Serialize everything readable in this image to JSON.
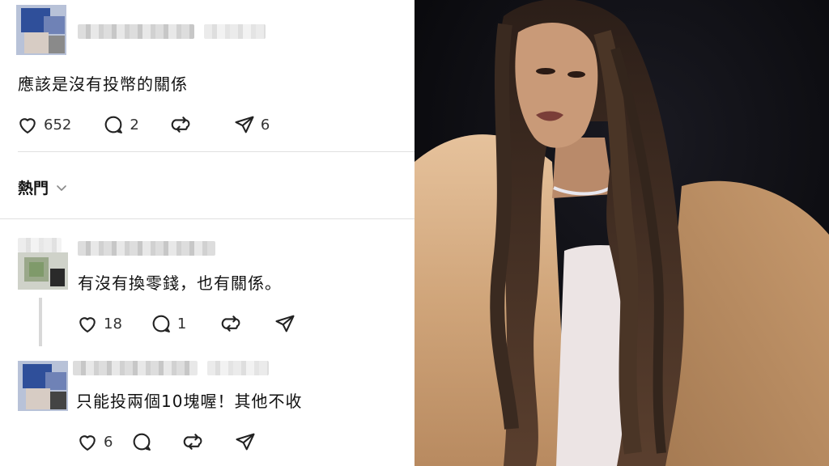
{
  "post": {
    "text": "應該是沒有投幣的關係",
    "likes": "652",
    "comments": "2",
    "shares": "6"
  },
  "sort": {
    "label": "熱門"
  },
  "replies": [
    {
      "text": "有沒有換零錢，也有關係。",
      "likes": "18",
      "comments": "1"
    },
    {
      "text": "只能投兩個10塊喔！其他不收",
      "likes": "6"
    }
  ],
  "colors": {
    "accent": "#111111",
    "divider": "#e0e0e0",
    "photo_bg": "#0a0a0e",
    "fur": "#d7ae86"
  },
  "icons": [
    "heart-icon",
    "comment-icon",
    "repost-icon",
    "share-icon",
    "chevron-down-icon"
  ]
}
